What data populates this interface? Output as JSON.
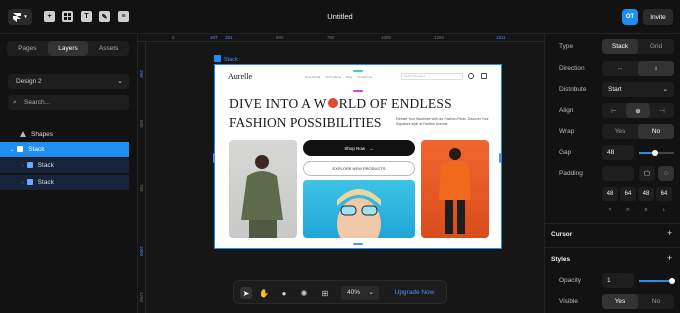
{
  "app": {
    "title": "Untitled",
    "avatar_initials": "OT",
    "invite_label": "Invite",
    "accent_color": "#1f8ef1"
  },
  "toolbar": {
    "logo_icon": "framer-logo-icon",
    "tools": [
      "add-icon",
      "grid-icon",
      "text-icon",
      "brush-icon",
      "database-icon"
    ]
  },
  "left_panel": {
    "tabs": [
      {
        "label": "Pages"
      },
      {
        "label": "Layers"
      },
      {
        "label": "Assets"
      }
    ],
    "active_tab": "Layers",
    "page_select": "Design 2",
    "search_placeholder": "Search...",
    "layers": [
      {
        "label": "Shapes"
      },
      {
        "label": "Stack"
      },
      {
        "label": "Stack"
      },
      {
        "label": "Stack"
      }
    ]
  },
  "canvas": {
    "ruler_h": [
      "0",
      "187",
      "281",
      "500",
      "750",
      "1000",
      "1250",
      "1511"
    ],
    "ruler_v": [
      "250",
      "500",
      "750",
      "1000",
      "1250"
    ],
    "frame_label": "Stack",
    "site": {
      "brand": "Aurelle",
      "nav_links": [
        "New Arrival",
        "All Products",
        "Blog",
        "Contact Us"
      ],
      "search_placeholder": "Search Product",
      "headline_line1": "DIVE INTO A W",
      "headline_line1_rest": "RLD OF ENDLESS",
      "headline_line2": "FASHION POSSIBILITIES",
      "subtext": "Elevate Your Wardrobe with our Fashion Finds. Discover Your Signature style at Fashion Avenue.",
      "shop_now": "Shop Now",
      "explore": "EXPLORE NEW PRODUCTS"
    }
  },
  "bottom_toolbar": {
    "zoom": "40%",
    "upgrade": "Upgrade Now"
  },
  "right_panel": {
    "type": {
      "label": "Type",
      "options": [
        "Stack",
        "Grid"
      ],
      "selected": "Stack"
    },
    "direction": {
      "label": "Direction",
      "options": [
        "↔",
        "↕"
      ],
      "selected": "↕"
    },
    "distribute": {
      "label": "Distribute",
      "value": "Start"
    },
    "align": {
      "label": "Align"
    },
    "wrap": {
      "label": "Wrap",
      "options": [
        "Yes",
        "No"
      ],
      "selected": "No"
    },
    "gap": {
      "label": "Gap",
      "value": "48"
    },
    "padding": {
      "label": "Padding",
      "values": [
        "48",
        "64",
        "48",
        "64"
      ],
      "sides": [
        "T",
        "R",
        "B",
        "L"
      ]
    },
    "cursor": {
      "label": "Cursor"
    },
    "styles": {
      "label": "Styles"
    },
    "opacity": {
      "label": "Opacity",
      "value": "1"
    },
    "visible": {
      "label": "Visible",
      "options": [
        "Yes",
        "No"
      ],
      "selected": "Yes"
    }
  }
}
